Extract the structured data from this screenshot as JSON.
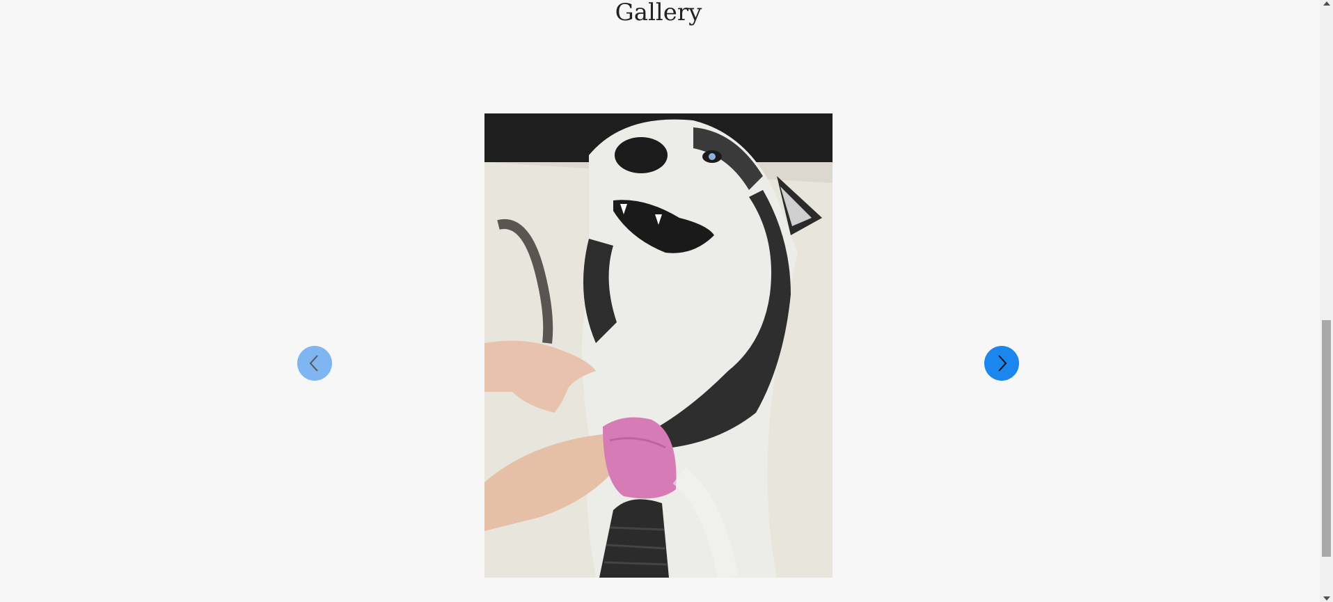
{
  "gallery": {
    "title": "Gallery",
    "image_subject": "husky-dog-being-groomed",
    "prev_icon": "chevron-left-icon",
    "next_icon": "chevron-right-icon"
  },
  "colors": {
    "background": "#f7f7f7",
    "prev_button": "#7fb5f1",
    "next_button": "#1a86ee",
    "arrow": "#1a1a1a"
  }
}
